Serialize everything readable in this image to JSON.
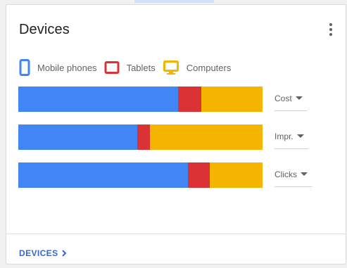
{
  "card": {
    "title": "Devices",
    "menu_icon": "more-vert-icon",
    "footer_link": "DEVICES"
  },
  "legend": [
    {
      "label": "Mobile phones",
      "icon": "mobile-phone-icon",
      "color": "#4285f4"
    },
    {
      "label": "Tablets",
      "icon": "tablet-icon",
      "color": "#db3236"
    },
    {
      "label": "Computers",
      "icon": "computer-icon",
      "color": "#f4b400"
    }
  ],
  "colors": {
    "mobile": "#4285f4",
    "tablet": "#db3236",
    "computer": "#f4b400",
    "link": "#3367d6"
  },
  "metrics": [
    {
      "label": "Cost",
      "shares": {
        "mobile": 0.655,
        "tablet": 0.095,
        "computer": 0.25
      }
    },
    {
      "label": "Impr.",
      "shares": {
        "mobile": 0.488,
        "tablet": 0.052,
        "computer": 0.46
      }
    },
    {
      "label": "Clicks",
      "shares": {
        "mobile": 0.695,
        "tablet": 0.09,
        "computer": 0.215
      }
    }
  ]
}
